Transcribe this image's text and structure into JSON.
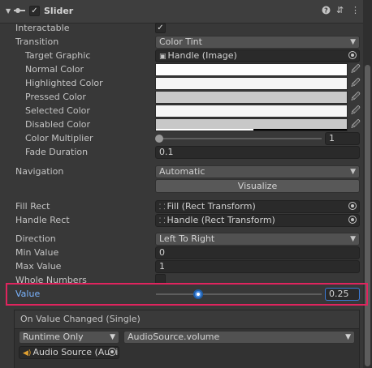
{
  "header": {
    "component_title": "Slider"
  },
  "properties": {
    "interactable_label": "Interactable",
    "transition_label": "Transition",
    "transition_value": "Color Tint",
    "target_graphic_label": "Target Graphic",
    "target_graphic_value": "Handle (Image)",
    "normal_color_label": "Normal Color",
    "highlighted_color_label": "Highlighted Color",
    "pressed_color_label": "Pressed Color",
    "selected_color_label": "Selected Color",
    "disabled_color_label": "Disabled Color",
    "color_multiplier_label": "Color Multiplier",
    "color_multiplier_value": "1",
    "fade_duration_label": "Fade Duration",
    "fade_duration_value": "0.1",
    "navigation_label": "Navigation",
    "navigation_value": "Automatic",
    "visualize_label": "Visualize",
    "fill_rect_label": "Fill Rect",
    "fill_rect_value": "Fill (Rect Transform)",
    "handle_rect_label": "Handle Rect",
    "handle_rect_value": "Handle (Rect Transform)",
    "direction_label": "Direction",
    "direction_value": "Left To Right",
    "min_value_label": "Min Value",
    "min_value_value": "0",
    "max_value_label": "Max Value",
    "max_value_value": "1",
    "whole_numbers_label": "Whole Numbers",
    "value_label": "Value",
    "value_value": "0.25"
  },
  "event": {
    "header_label": "On Value Changed (Single)",
    "runtime_value": "Runtime Only",
    "function_value": "AudioSource.volume",
    "object_value": "Audio Source (Audio"
  },
  "colors": {
    "normal": "#ffffff",
    "highlighted": "#f5f5f5",
    "pressed": "#c8c8c8",
    "selected": "#f5f5f5",
    "disabled": "#c8c8c8",
    "highlight_box": "#e0245e",
    "accent_text": "#7ab4ff"
  },
  "sliders": {
    "color_multiplier_level": 1,
    "value_level": 0.25
  }
}
